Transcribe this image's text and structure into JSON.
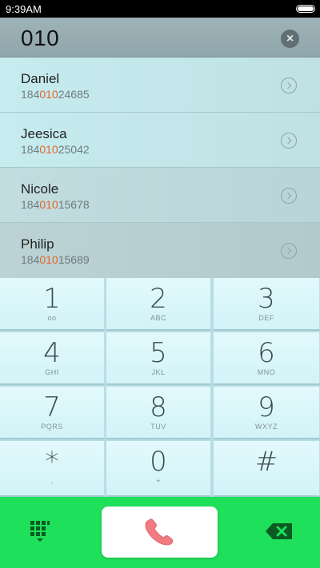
{
  "status_bar": {
    "time": "9:39AM"
  },
  "dial_bar": {
    "number": "010",
    "clear_symbol": "×"
  },
  "contacts": [
    {
      "name": "Daniel",
      "number_prefix": "184",
      "number_match": "010",
      "number_suffix": "24685"
    },
    {
      "name": "Jeesica",
      "number_prefix": "184",
      "number_match": "010",
      "number_suffix": "25042"
    },
    {
      "name": "Nicole",
      "number_prefix": "184",
      "number_match": "010",
      "number_suffix": "15678"
    },
    {
      "name": "Philip",
      "number_prefix": "184",
      "number_match": "010",
      "number_suffix": "15689"
    }
  ],
  "keypad": [
    {
      "digit": "1",
      "letters": "ᴏᴏ"
    },
    {
      "digit": "2",
      "letters": "ABC"
    },
    {
      "digit": "3",
      "letters": "DEF"
    },
    {
      "digit": "4",
      "letters": "GHI"
    },
    {
      "digit": "5",
      "letters": "JKL"
    },
    {
      "digit": "6",
      "letters": "MNO"
    },
    {
      "digit": "7",
      "letters": "PQRS"
    },
    {
      "digit": "8",
      "letters": "TUV"
    },
    {
      "digit": "9",
      "letters": "WXYZ"
    },
    {
      "digit": "*",
      "letters": ","
    },
    {
      "digit": "0",
      "letters": "+"
    },
    {
      "digit": "#",
      "letters": ""
    }
  ],
  "colors": {
    "accent_green": "#1ee05a",
    "match_highlight": "#e0662b",
    "call_icon": "#f07b80"
  },
  "icons": {
    "keypad_toggle": "dialpad-grid-icon",
    "call": "phone-handset-icon",
    "delete": "backspace-icon"
  }
}
